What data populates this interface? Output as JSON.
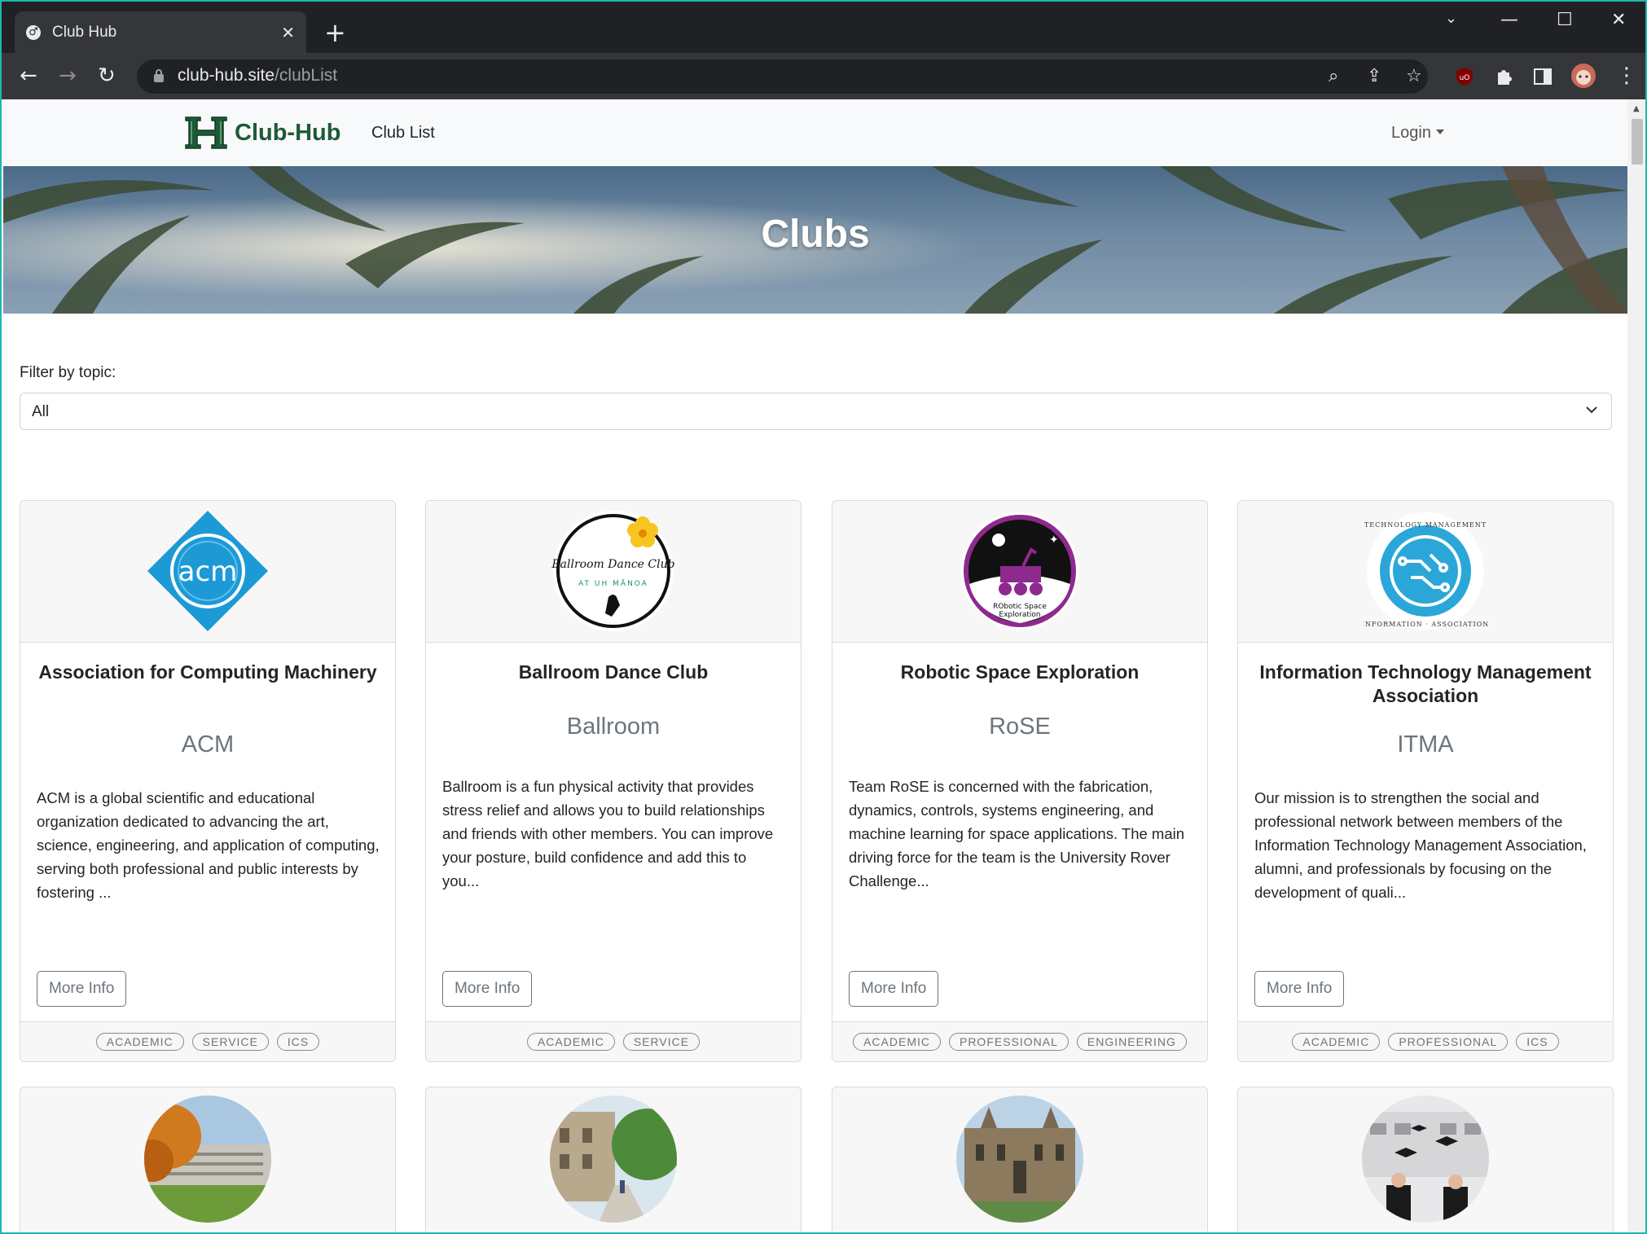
{
  "browser": {
    "tab_title": "Club Hub",
    "url_domain": "club-hub.site",
    "url_path": "/clubList"
  },
  "site": {
    "brand": "Club-Hub",
    "nav_link": "Club List",
    "login": "Login"
  },
  "hero": {
    "title": "Clubs"
  },
  "filter": {
    "label": "Filter by topic:",
    "selected": "All"
  },
  "cards": [
    {
      "title": "Association for Computing Machinery",
      "abbr": "ACM",
      "description": "ACM is a global scientific and educational organization dedicated to advancing the art, science, engineering, and application of computing, serving both professional and public interests by fostering ...",
      "button": "More Info",
      "tags": [
        "ACADEMIC",
        "SERVICE",
        "ICS"
      ],
      "logo_text": "acm"
    },
    {
      "title": "Ballroom Dance Club",
      "abbr": "Ballroom",
      "description": "Ballroom is a fun physical activity that provides stress relief and allows you to build relationships and friends with other members. You can improve your posture, build confidence and add this to you...",
      "button": "More Info",
      "tags": [
        "ACADEMIC",
        "SERVICE"
      ],
      "logo_text": "Ballroom Dance Club",
      "logo_subtext": "AT UH MĀNOA"
    },
    {
      "title": "Robotic Space Exploration",
      "abbr": "RoSE",
      "description": "Team RoSE is concerned with the fabrication, dynamics, controls, systems engineering, and machine learning for space applications. The main driving force for the team is the University Rover Challenge...",
      "button": "More Info",
      "tags": [
        "ACADEMIC",
        "PROFESSIONAL",
        "ENGINEERING"
      ],
      "logo_text": "RObotic Space",
      "logo_subtext": "Exploration"
    },
    {
      "title": "Information Technology Management Association",
      "abbr": "ITMA",
      "description": "Our mission is to strengthen the social and professional network between members of the Information Technology Management Association, alumni, and professionals by focusing on the development of quali...",
      "button": "More Info",
      "tags": [
        "ACADEMIC",
        "PROFESSIONAL",
        "ICS"
      ],
      "logo_text": "TECHNOLOGY MANAGEMENT",
      "logo_subtext": "INFORMATION · ASSOCIATION"
    }
  ],
  "colors": {
    "brand_green": "#1d5b36",
    "acm_blue": "#1d9ad6",
    "rose_purple": "#8e2a8e",
    "itma_blue": "#2aa7d8"
  }
}
